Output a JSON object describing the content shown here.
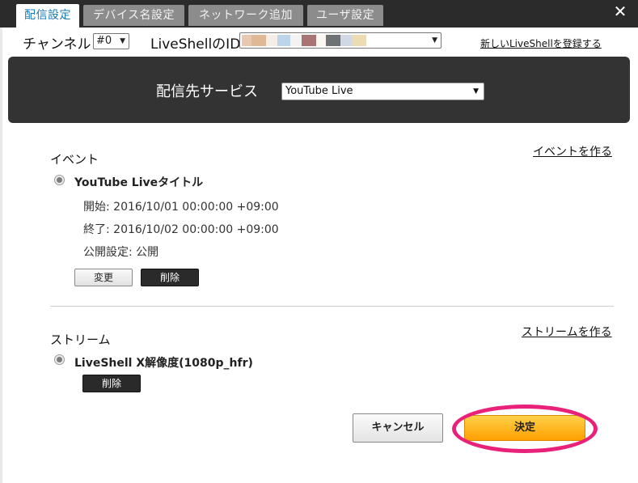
{
  "tabs": [
    {
      "label": "配信設定",
      "active": true
    },
    {
      "label": "デバイス名設定",
      "active": false
    },
    {
      "label": "ネットワーク追加",
      "active": false
    },
    {
      "label": "ユーザ設定",
      "active": false
    }
  ],
  "close_icon": "close-icon",
  "channel": {
    "label": "チャンネル",
    "value": "#0"
  },
  "liveshell_id": {
    "label": "LiveShellのID",
    "swatches": [
      "#e8c8b0",
      "#dfb996",
      "#f4eee6",
      "#bcd5e8",
      "#f3f3f3",
      "#a97574",
      "#faf7f2",
      "#6e7275",
      "#d0d8e6",
      "#ecdcb4",
      "#ffffff"
    ]
  },
  "register_link": "新しいLiveShellを登録する",
  "service": {
    "label": "配信先サービス",
    "value": "YouTube Live"
  },
  "event": {
    "section_title": "イベント",
    "create_link": "イベントを作る",
    "title": "YouTube Liveタイトル",
    "start": "開始: 2016/10/01 00:00:00 +09:00",
    "end": "終了: 2016/10/02 00:00:00 +09:00",
    "visibility": "公開設定: 公開",
    "change_label": "変更",
    "delete_label": "削除"
  },
  "stream": {
    "section_title": "ストリーム",
    "create_link": "ストリームを作る",
    "title": "LiveShell X解像度(1080p_hfr)",
    "delete_label": "削除"
  },
  "footer": {
    "cancel_label": "キャンセル",
    "ok_label": "決定"
  },
  "colors": {
    "accent_tab_text": "#1a78b5",
    "panel_bg": "#333333",
    "ok_button": "#ffb300",
    "highlight_ring": "#e8217a"
  }
}
